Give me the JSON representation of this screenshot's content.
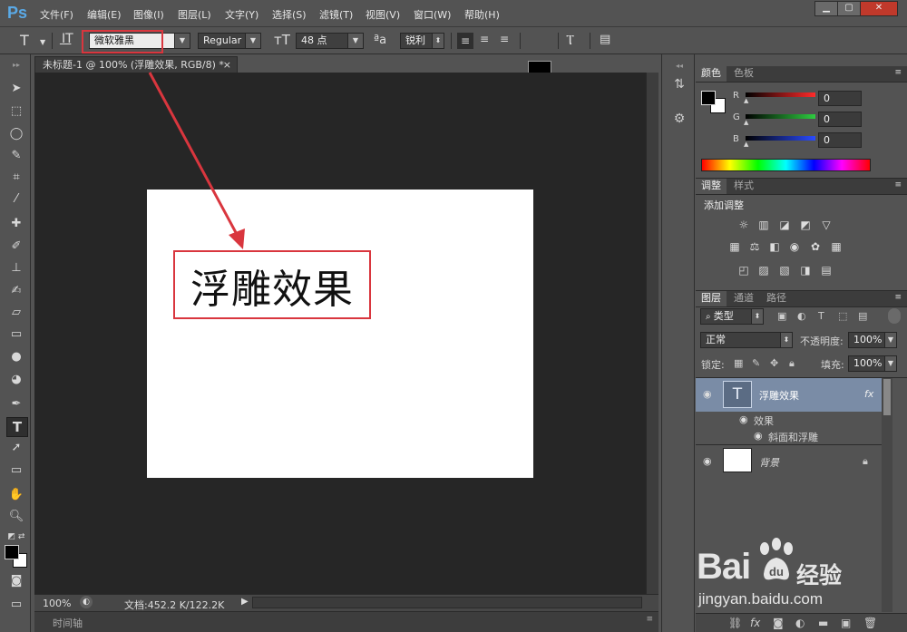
{
  "app": {
    "logo": "Ps",
    "menu": [
      "文件(F)",
      "编辑(E)",
      "图像(I)",
      "图层(L)",
      "文字(Y)",
      "选择(S)",
      "滤镜(T)",
      "视图(V)",
      "窗口(W)",
      "帮助(H)"
    ],
    "window_buttons": {
      "minimize": "▁",
      "restore": "▢",
      "close": "✕"
    }
  },
  "options": {
    "tool_icon": "T",
    "font_family": "微软雅黑",
    "font_style": "Regular",
    "font_size": "48 点",
    "aa_icon": "ªa",
    "antialias": "锐利"
  },
  "document": {
    "tab_title": "未标题-1 @ 100% (浮雕效果, RGB/8) *",
    "tab_close": "×",
    "canvas_text": "浮雕效果",
    "zoom": "100%",
    "doc_info": "文档:452.2 K/122.2K",
    "timeline": "时间轴"
  },
  "color_panel": {
    "tabs": [
      "颜色",
      "色板"
    ],
    "channels": [
      {
        "label": "R",
        "value": "0",
        "color": "#ff2a2a"
      },
      {
        "label": "G",
        "value": "0",
        "color": "#2ecc40"
      },
      {
        "label": "B",
        "value": "0",
        "color": "#2a4bff"
      }
    ]
  },
  "adjustments_panel": {
    "tabs": [
      "调整",
      "样式"
    ],
    "title": "添加调整"
  },
  "layers_panel": {
    "tabs": [
      "图层",
      "通道",
      "路径"
    ],
    "filter_kind": "类型",
    "blend_mode": "正常",
    "opacity_label": "不透明度:",
    "opacity_value": "100%",
    "lock_label": "锁定:",
    "fill_label": "填充:",
    "fill_value": "100%",
    "layers": [
      {
        "name": "浮雕效果",
        "thumb": "T",
        "fx": "fx"
      },
      {
        "name": "背景"
      }
    ],
    "effects_label": "效果",
    "effect_item": "斜面和浮雕"
  },
  "watermark": {
    "brand": "Bai",
    "brand_cn": "经验",
    "url": "jingyan.baidu.com"
  },
  "colors": {
    "accent_red": "#d9363e",
    "ps_blue": "#5aa9e6",
    "selected_layer": "#7a8ca6"
  }
}
